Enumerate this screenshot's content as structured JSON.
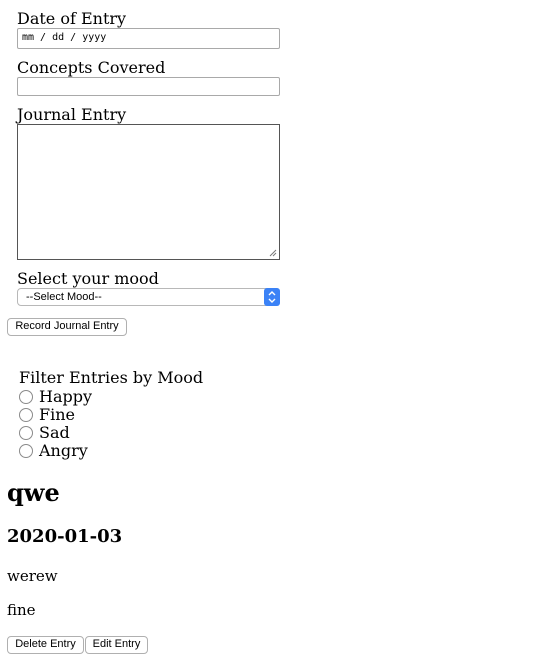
{
  "form": {
    "date_label": "Date of Entry",
    "date_placeholder": "mm / dd / yyyy",
    "concepts_label": "Concepts Covered",
    "concepts_value": "",
    "journal_label": "Journal Entry",
    "journal_value": "",
    "mood_label": "Select your mood",
    "mood_selected": "--Select Mood--",
    "submit_label": "Record Journal Entry"
  },
  "filter": {
    "label": "Filter Entries by Mood",
    "options": [
      "Happy",
      "Fine",
      "Sad",
      "Angry"
    ]
  },
  "entry": {
    "title": "qwe",
    "date": "2020-01-03",
    "journal": "werew",
    "mood": "fine",
    "delete_label": "Delete Entry",
    "edit_label": "Edit Entry"
  }
}
